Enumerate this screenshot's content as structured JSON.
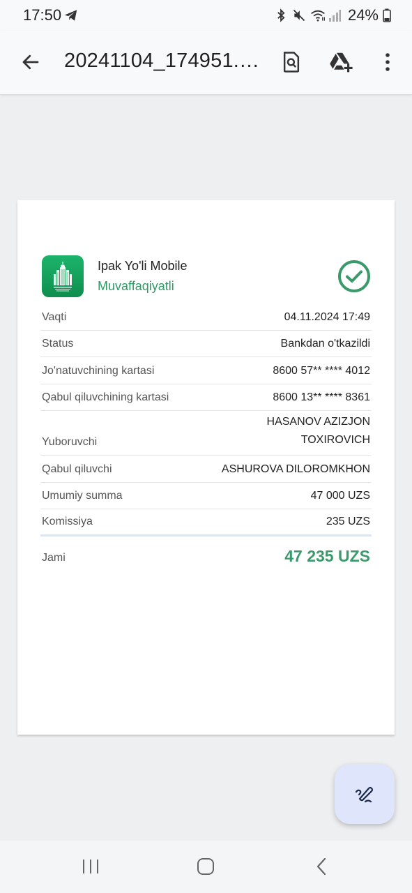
{
  "status_bar": {
    "time": "17:50",
    "left_icon": "telegram-icon",
    "icons": [
      "bluetooth-icon",
      "mute-icon",
      "wifi-icon",
      "signal-icon",
      "battery-icon"
    ],
    "battery": "24%"
  },
  "app_bar": {
    "back_icon": "arrow-back-icon",
    "title": "20241104_174951.pdf",
    "actions": [
      "search-document-icon",
      "add-to-drive-icon",
      "more-vert-icon"
    ]
  },
  "receipt": {
    "logo": "ipak-yoli-logo",
    "bank_name": "Ipak Yo'li Mobile",
    "status": "Muvaffaqiyatli",
    "status_icon": "check-circle-icon",
    "rows": [
      {
        "label": "Vaqti",
        "value": "04.11.2024 17:49"
      },
      {
        "label": "Status",
        "value": "Bankdan o'tkazildi"
      },
      {
        "label": "Jo'natuvchining kartasi",
        "value": "8600 57** **** 4012"
      },
      {
        "label": "Qabul qiluvchining kartasi",
        "value": "8600 13** **** 8361"
      },
      {
        "label": "Yuboruvchi",
        "value_line1": "HASANOV AZIZJON",
        "value_line2": "TOXIROVICH"
      },
      {
        "label": "Qabul qiluvchi",
        "value": "ASHUROVA DILOROMKHON"
      },
      {
        "label": "Umumiy summa",
        "value": "47 000 UZS"
      },
      {
        "label": "Komissiya",
        "value": "235 UZS"
      }
    ],
    "total": {
      "label": "Jami",
      "value": "47 235 UZS"
    }
  },
  "fab": {
    "icon": "edit-pen-icon"
  },
  "nav_bar": {
    "buttons": [
      "recents-icon",
      "home-icon",
      "back-icon"
    ]
  },
  "colors": {
    "accent_green": "#3a9a6c",
    "fab_bg": "#dfe5fb",
    "logo_green": "#16a05c"
  }
}
